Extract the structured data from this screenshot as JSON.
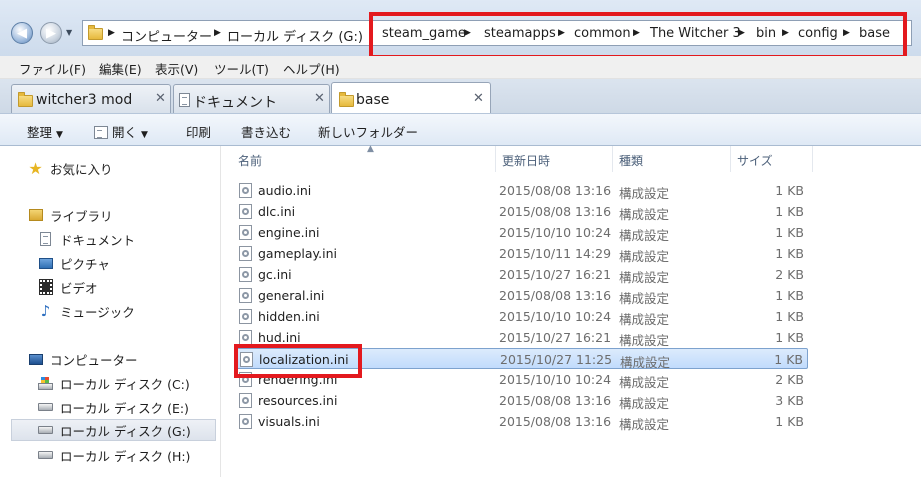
{
  "address": {
    "crumbs": [
      "コンピューター",
      "ローカル ディスク (G:)",
      "steam_game",
      "steamapps",
      "common",
      "The Witcher 3",
      "bin",
      "config",
      "base"
    ]
  },
  "menu": [
    "ファイル(F)",
    "編集(E)",
    "表示(V)",
    "ツール(T)",
    "ヘルプ(H)"
  ],
  "tabs": [
    {
      "label": "witcher3 mod",
      "icon": "folder-icon"
    },
    {
      "label": "ドキュメント",
      "icon": "document-icon"
    },
    {
      "label": "base",
      "icon": "folder-icon",
      "active": true
    }
  ],
  "commands": {
    "organize": "整理",
    "open": "開く",
    "print": "印刷",
    "burn": "書き込む",
    "new_folder": "新しいフォルダー"
  },
  "nav": {
    "favorites": "お気に入り",
    "libraries": "ライブラリ",
    "documents": "ドキュメント",
    "pictures": "ピクチャ",
    "videos": "ビデオ",
    "music": "ミュージック",
    "computer": "コンピューター",
    "drive_c": "ローカル ディスク (C:)",
    "drive_e": "ローカル ディスク (E:)",
    "drive_g": "ローカル ディスク (G:)",
    "drive_h": "ローカル ディスク (H:)"
  },
  "columns": {
    "name": "名前",
    "date": "更新日時",
    "type": "種類",
    "size": "サイズ"
  },
  "files": [
    {
      "name": "audio.ini",
      "date": "2015/08/08 13:16",
      "type": "構成設定",
      "size": "1 KB"
    },
    {
      "name": "dlc.ini",
      "date": "2015/08/08 13:16",
      "type": "構成設定",
      "size": "1 KB"
    },
    {
      "name": "engine.ini",
      "date": "2015/10/10 10:24",
      "type": "構成設定",
      "size": "1 KB"
    },
    {
      "name": "gameplay.ini",
      "date": "2015/10/11 14:29",
      "type": "構成設定",
      "size": "1 KB"
    },
    {
      "name": "gc.ini",
      "date": "2015/10/27 16:21",
      "type": "構成設定",
      "size": "2 KB"
    },
    {
      "name": "general.ini",
      "date": "2015/08/08 13:16",
      "type": "構成設定",
      "size": "1 KB"
    },
    {
      "name": "hidden.ini",
      "date": "2015/10/10 10:24",
      "type": "構成設定",
      "size": "1 KB"
    },
    {
      "name": "hud.ini",
      "date": "2015/10/27 16:21",
      "type": "構成設定",
      "size": "1 KB"
    },
    {
      "name": "localization.ini",
      "date": "2015/10/27 11:25",
      "type": "構成設定",
      "size": "1 KB",
      "selected": true
    },
    {
      "name": "rendering.ini",
      "date": "2015/10/10 10:24",
      "type": "構成設定",
      "size": "2 KB"
    },
    {
      "name": "resources.ini",
      "date": "2015/08/08 13:16",
      "type": "構成設定",
      "size": "3 KB"
    },
    {
      "name": "visuals.ini",
      "date": "2015/08/08 13:16",
      "type": "構成設定",
      "size": "1 KB"
    }
  ],
  "highlight_color": "#e3191e"
}
